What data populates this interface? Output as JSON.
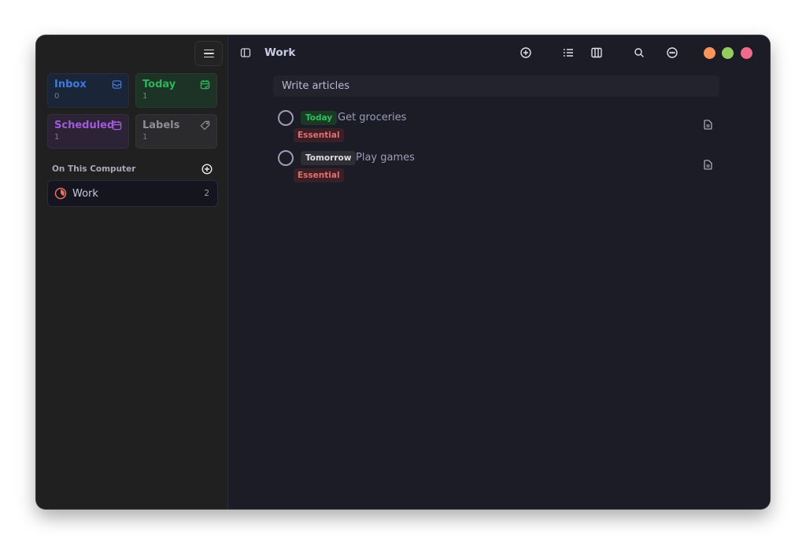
{
  "sidebar": {
    "menu_icon": "hamburger-menu-icon",
    "cards": [
      {
        "label": "Inbox",
        "count": "0",
        "icon": "inbox-tray-icon"
      },
      {
        "label": "Today",
        "count": "1",
        "icon": "calendar-check-icon"
      },
      {
        "label": "Scheduled",
        "count": "1",
        "icon": "calendar-icon"
      },
      {
        "label": "Labels",
        "count": "1",
        "icon": "tag-icon"
      }
    ],
    "section": {
      "title": "On This Computer",
      "add_icon": "plus-circle-icon"
    },
    "projects": [
      {
        "name": "Work",
        "count": "2",
        "icon": "progress-pie-icon",
        "color": "#e8705f"
      }
    ]
  },
  "main": {
    "title": "Work",
    "toolbar": {
      "icons": [
        "sidebar-toggle-icon",
        "add-circle-icon",
        "list-view-icon",
        "board-view-icon",
        "search-icon",
        "more-options-icon"
      ]
    },
    "window_controls": {
      "minimize": "#f7955a",
      "maximize": "#94cd5b",
      "close": "#f06a8c"
    },
    "new_task_placeholder": "Write articles",
    "tasks": [
      {
        "due": "Today",
        "title": "Get groceries",
        "label": "Essential",
        "note_icon": "note-document-icon"
      },
      {
        "due": "Tomorrow",
        "title": "Play games",
        "label": "Essential",
        "note_icon": "note-document-icon"
      }
    ]
  },
  "colors": {
    "inbox": "#3d7be0",
    "today": "#2fb45a",
    "scheduled": "#a25ad8",
    "label_essential": "#e0706e",
    "project_work": "#e8705f"
  }
}
